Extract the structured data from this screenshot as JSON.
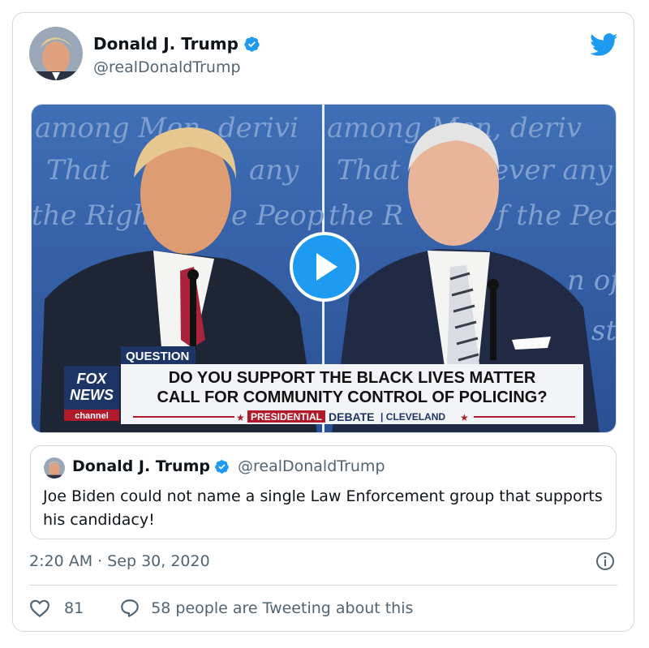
{
  "tweet": {
    "author_name": "Donald J. Trump",
    "author_handle": "@realDonaldTrump",
    "timestamp": "2:20 AM · Sep 30, 2020"
  },
  "video": {
    "lower_third": {
      "tag": "QUESTION",
      "headline_line1": "DO YOU SUPPORT THE BLACK LIVES MATTER",
      "headline_line2": "CALL FOR COMMUNITY CONTROL OF POLICING?",
      "event_part1": "PRESIDENTIAL",
      "event_part2": "DEBATE",
      "event_part3": "| CLEVELAND",
      "network_line1": "FOX",
      "network_line2": "NEWS",
      "network_line3": "channel"
    },
    "backdrop_text_left": [
      "among Men, derivi",
      "That",
      "any",
      "the Righ",
      "e Peop"
    ],
    "backdrop_text_right": [
      "among Men, deriv",
      "That",
      "ever any",
      "the R",
      "f the Peop",
      "n of",
      "st"
    ]
  },
  "quoted_tweet": {
    "author_name": "Donald J. Trump",
    "author_handle": "@realDonaldTrump",
    "text": "Joe Biden could not name a single Law Enforcement group that supports his candidacy!"
  },
  "footer": {
    "like_count": "81",
    "reply_text": "58 people are Tweeting about this"
  },
  "icons": {
    "brand": "twitter-bird-icon",
    "verified": "verified-badge-icon",
    "play": "play-icon",
    "info": "info-icon",
    "like": "heart-icon",
    "reply": "speech-bubble-icon"
  },
  "colors": {
    "twitter_blue": "#1d9bf0",
    "verified_blue": "#1d9bf0",
    "secondary_text": "#536471",
    "border": "#cfd9de",
    "fox_red": "#b11a2b",
    "fox_navy": "#1d3566"
  }
}
